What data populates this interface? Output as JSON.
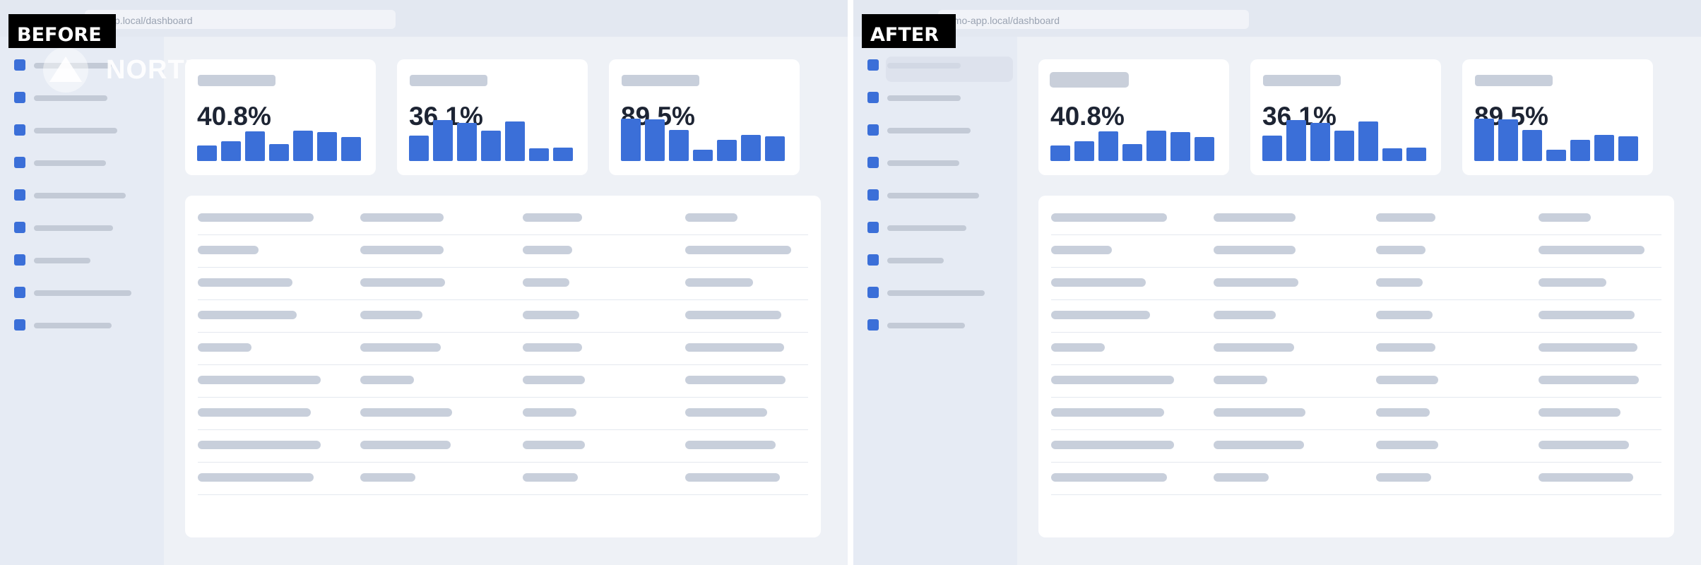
{
  "tags": {
    "before": "BEFORE",
    "after": "AFTER"
  },
  "browser": {
    "before_url": "e-app.local/dashboard",
    "after_url": "emo-app.local/dashboard"
  },
  "logo": {
    "text": "NORTHPEAK"
  },
  "metrics": [
    {
      "value": "40.8%",
      "bars": [
        0.36,
        0.46,
        0.7,
        0.4,
        0.72,
        0.68,
        0.56
      ]
    },
    {
      "value": "36.1%",
      "bars": [
        0.6,
        0.96,
        0.9,
        0.72,
        0.94,
        0.3,
        0.32
      ]
    },
    {
      "value": "89.5%",
      "bars": [
        1.0,
        0.98,
        0.74,
        0.26,
        0.5,
        0.62,
        0.58
      ]
    }
  ],
  "sidebar": {
    "item_count": 9
  },
  "table": {
    "row_count": 9,
    "column_count": 4
  },
  "colors": {
    "accent": "#3b6fd8",
    "placeholder": "#c8cfdb",
    "sidebar": "#e6ebf4",
    "background": "#eef1f6"
  }
}
